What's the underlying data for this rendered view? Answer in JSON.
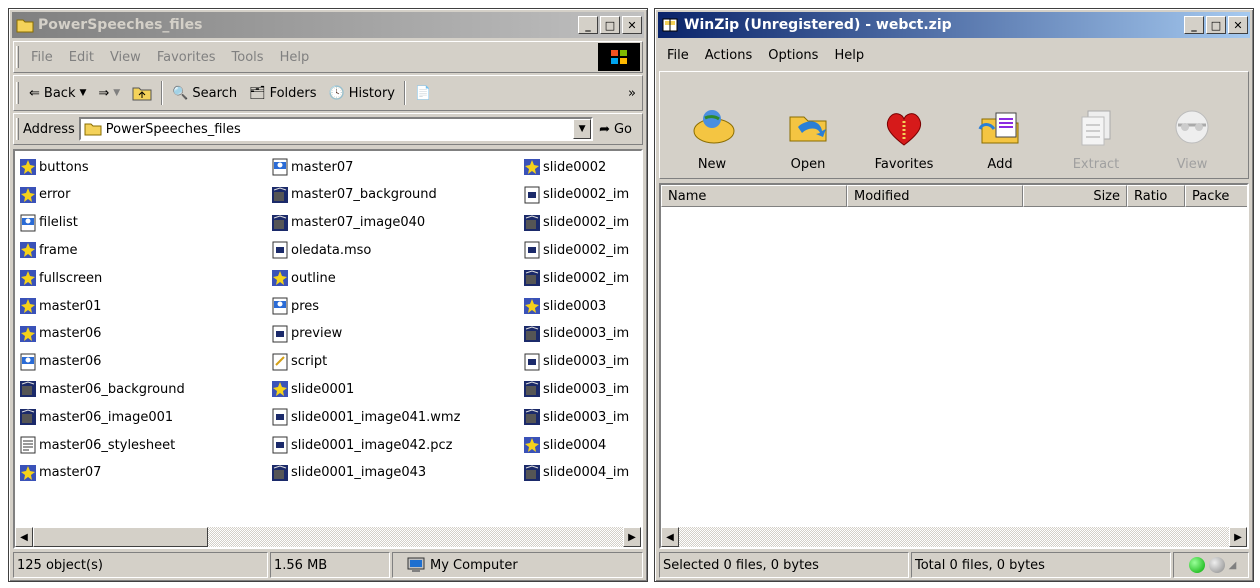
{
  "explorer": {
    "title": "PowerSpeeches_files",
    "menu": [
      "File",
      "Edit",
      "View",
      "Favorites",
      "Tools",
      "Help"
    ],
    "toolbar": {
      "back": "Back",
      "search": "Search",
      "folders": "Folders",
      "history": "History",
      "more": "»"
    },
    "address": {
      "label": "Address",
      "value": "PowerSpeeches_files",
      "go": "Go"
    },
    "files": [
      {
        "name": "buttons",
        "icon": "html-page-icon"
      },
      {
        "name": "error",
        "icon": "html-page-icon"
      },
      {
        "name": "filelist",
        "icon": "xml-file-icon"
      },
      {
        "name": "frame",
        "icon": "html-page-icon"
      },
      {
        "name": "fullscreen",
        "icon": "html-page-icon"
      },
      {
        "name": "master01",
        "icon": "html-page-icon"
      },
      {
        "name": "master06",
        "icon": "html-page-icon"
      },
      {
        "name": "master06",
        "icon": "xml-file-icon"
      },
      {
        "name": "master06_background",
        "icon": "image-file-icon"
      },
      {
        "name": "master06_image001",
        "icon": "image-file-icon"
      },
      {
        "name": "master06_stylesheet",
        "icon": "stylesheet-icon"
      },
      {
        "name": "master07",
        "icon": "html-page-icon"
      },
      {
        "name": "master07",
        "icon": "xml-file-icon"
      },
      {
        "name": "master07_background",
        "icon": "image-file-icon"
      },
      {
        "name": "master07_image040",
        "icon": "image-file-icon"
      },
      {
        "name": "oledata.mso",
        "icon": "data-file-icon"
      },
      {
        "name": "outline",
        "icon": "html-page-icon"
      },
      {
        "name": "pres",
        "icon": "xml-file-icon"
      },
      {
        "name": "preview",
        "icon": "data-file-icon"
      },
      {
        "name": "script",
        "icon": "script-file-icon"
      },
      {
        "name": "slide0001",
        "icon": "html-page-icon"
      },
      {
        "name": "slide0001_image041.wmz",
        "icon": "data-file-icon"
      },
      {
        "name": "slide0001_image042.pcz",
        "icon": "data-file-icon"
      },
      {
        "name": "slide0001_image043",
        "icon": "image-file-icon"
      },
      {
        "name": "slide0002",
        "icon": "html-page-icon"
      },
      {
        "name": "slide0002_im",
        "icon": "data-file-icon"
      },
      {
        "name": "slide0002_im",
        "icon": "image-file-icon"
      },
      {
        "name": "slide0002_im",
        "icon": "data-file-icon"
      },
      {
        "name": "slide0002_im",
        "icon": "image-file-icon"
      },
      {
        "name": "slide0003",
        "icon": "html-page-icon"
      },
      {
        "name": "slide0003_im",
        "icon": "image-file-icon"
      },
      {
        "name": "slide0003_im",
        "icon": "data-file-icon"
      },
      {
        "name": "slide0003_im",
        "icon": "image-file-icon"
      },
      {
        "name": "slide0003_im",
        "icon": "image-file-icon"
      },
      {
        "name": "slide0004",
        "icon": "html-page-icon"
      },
      {
        "name": "slide0004_im",
        "icon": "image-file-icon"
      }
    ],
    "status": {
      "objects": "125 object(s)",
      "size": "1.56 MB",
      "zone": "My Computer"
    }
  },
  "winzip": {
    "title": "WinZip (Unregistered) - webct.zip",
    "menu": [
      "File",
      "Actions",
      "Options",
      "Help"
    ],
    "toolbar": [
      {
        "label": "New",
        "icon": "new-archive-icon",
        "enabled": true
      },
      {
        "label": "Open",
        "icon": "open-archive-icon",
        "enabled": true
      },
      {
        "label": "Favorites",
        "icon": "favorites-heart-icon",
        "enabled": true
      },
      {
        "label": "Add",
        "icon": "add-files-icon",
        "enabled": true
      },
      {
        "label": "Extract",
        "icon": "extract-icon",
        "enabled": false
      },
      {
        "label": "View",
        "icon": "view-icon",
        "enabled": false
      }
    ],
    "columns": [
      "Name",
      "Modified",
      "Size",
      "Ratio",
      "Packe"
    ],
    "status": {
      "selected": "Selected 0 files, 0 bytes",
      "total": "Total 0 files, 0 bytes"
    }
  }
}
